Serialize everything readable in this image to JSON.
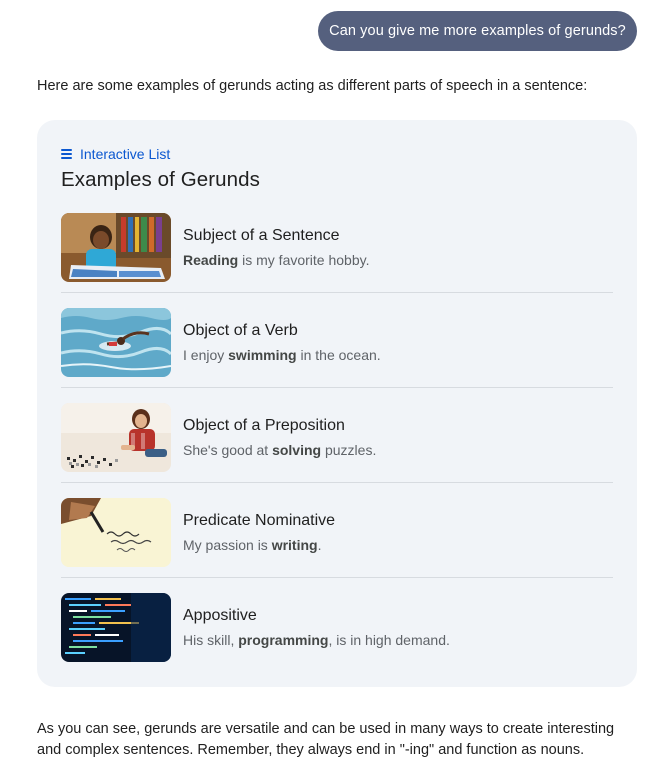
{
  "user_message": "Can you give me more examples of gerunds?",
  "response": {
    "intro": "Here are some examples of gerunds acting as different parts of speech in a sentence:",
    "outro": "As you can see, gerunds are versatile and can be used in many ways to create interesting and complex sentences. Remember, they always end in \"-ing\" and function as nouns."
  },
  "card": {
    "kicker_icon": "list-icon",
    "kicker": "Interactive List",
    "title": "Examples of Gerunds",
    "items": [
      {
        "title": "Subject of a Sentence",
        "pre": "",
        "bold": "Reading",
        "post": " is my favorite hobby.",
        "image": "girl-reading-book"
      },
      {
        "title": "Object of a Verb",
        "pre": "I enjoy ",
        "bold": "swimming",
        "post": " in the ocean.",
        "image": "person-swimming-ocean"
      },
      {
        "title": "Object of a Preposition",
        "pre": "She's good at ",
        "bold": "solving",
        "post": " puzzles.",
        "image": "woman-solving-puzzle"
      },
      {
        "title": "Predicate Nominative",
        "pre": "My passion is ",
        "bold": "writing",
        "post": ".",
        "image": "hand-writing-paper"
      },
      {
        "title": "Appositive",
        "pre": "His skill, ",
        "bold": "programming",
        "post": ", is in high demand.",
        "image": "code-on-screen"
      }
    ]
  },
  "colors": {
    "user_bubble": "#55607e",
    "card_bg": "#f1f4f8",
    "accent": "#0b57d0"
  }
}
